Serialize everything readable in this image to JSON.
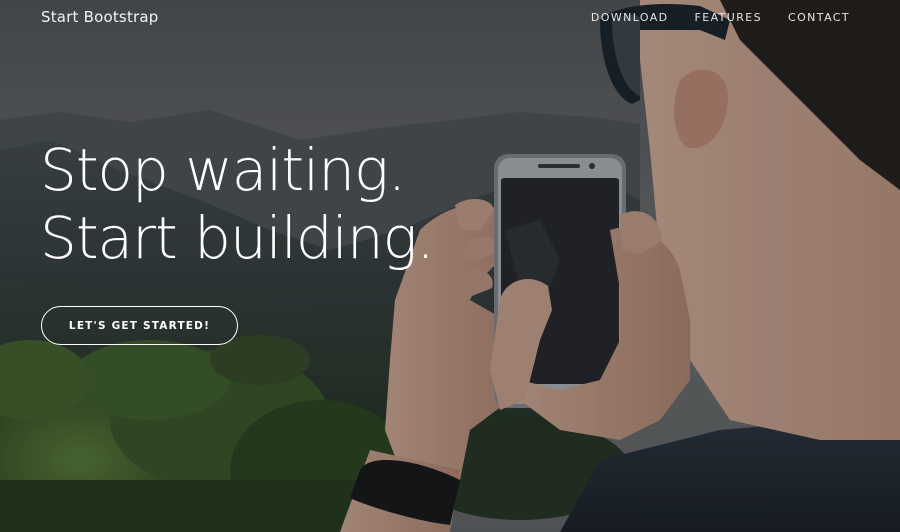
{
  "navbar": {
    "brand": "Start Bootstrap",
    "links": [
      "DOWNLOAD",
      "FEATURES",
      "CONTACT"
    ]
  },
  "hero": {
    "headline_line1": "Stop waiting.",
    "headline_line2": "Start building.",
    "cta_label": "LET'S GET STARTED!"
  },
  "colors": {
    "text": "#ffffff",
    "sky": "#6d7176",
    "mountain": "#3f4a4f",
    "foliage": "#3a5a2e",
    "skin": "#c9a08c"
  }
}
